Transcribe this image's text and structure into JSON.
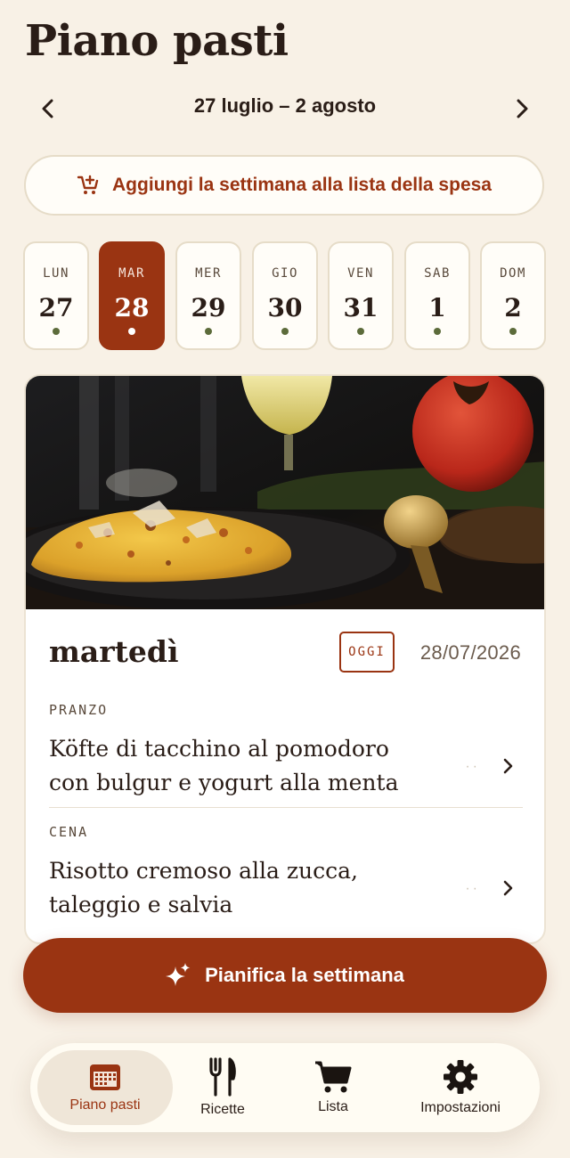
{
  "header": {
    "title": "Piano pasti"
  },
  "week_nav": {
    "label": "27 luglio – 2 agosto"
  },
  "add_week_button": {
    "label": "Aggiungi la settimana alla lista della spesa",
    "icon": "cart-plus-icon"
  },
  "days": [
    {
      "dow": "LUN",
      "num": "27",
      "selected": false
    },
    {
      "dow": "MAR",
      "num": "28",
      "selected": true
    },
    {
      "dow": "MER",
      "num": "29",
      "selected": false
    },
    {
      "dow": "GIO",
      "num": "30",
      "selected": false
    },
    {
      "dow": "VEN",
      "num": "31",
      "selected": false
    },
    {
      "dow": "SAB",
      "num": "1",
      "selected": false
    },
    {
      "dow": "DOM",
      "num": "2",
      "selected": false
    }
  ],
  "day_detail": {
    "name": "martedì",
    "badge": "OGGI",
    "date": "28/07/2026",
    "meals": [
      {
        "label": "PRANZO",
        "title": "Köfte di tacchino al pomodoro con bulgur e yogurt alla menta"
      },
      {
        "label": "CENA",
        "title": "Risotto cremoso alla zucca, taleggio e salvia"
      }
    ]
  },
  "plan_button": {
    "label": "Pianifica la settimana",
    "icon": "sparkles-icon"
  },
  "tabs": [
    {
      "label": "Piano pasti",
      "icon": "calendar-icon",
      "active": true
    },
    {
      "label": "Ricette",
      "icon": "fork-knife-icon",
      "active": false
    },
    {
      "label": "Lista",
      "icon": "shopping-cart-icon",
      "active": false
    },
    {
      "label": "Impostazioni",
      "icon": "gear-icon",
      "active": false
    }
  ],
  "colors": {
    "background": "#f8f1e6",
    "accent": "#9a3412",
    "text": "#2a1d17",
    "dot": "#5c6b3a"
  }
}
